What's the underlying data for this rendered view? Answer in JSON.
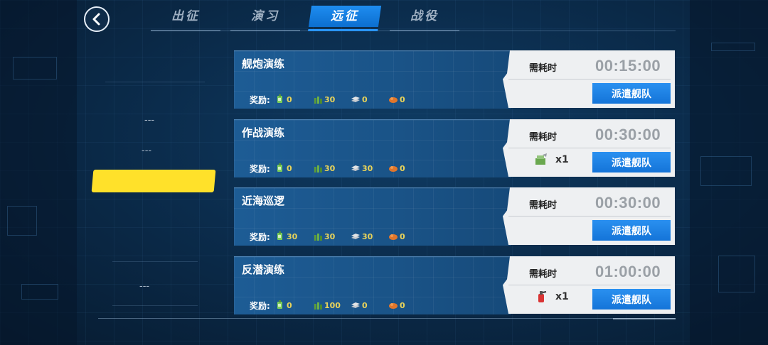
{
  "tabs": [
    {
      "label": "出征",
      "active": false
    },
    {
      "label": "演习",
      "active": false
    },
    {
      "label": "远征",
      "active": true
    },
    {
      "label": "战役",
      "active": false
    }
  ],
  "left_panel": {
    "placeholders": [
      "---",
      "---",
      "---"
    ],
    "selected_color": "#ffe12a"
  },
  "reward_label": "奖励:",
  "need_label": "需耗时",
  "dispatch_label": "派遣舰队",
  "expeditions": [
    {
      "title": "舰炮演练",
      "time": "00:15:00",
      "rewards": {
        "fuel": "0",
        "ammo": "30",
        "steel": "0",
        "bauxite": "0"
      },
      "extra": null
    },
    {
      "title": "作战演练",
      "time": "00:30:00",
      "rewards": {
        "fuel": "0",
        "ammo": "30",
        "steel": "30",
        "bauxite": "0"
      },
      "extra": {
        "icon": "build-material-icon",
        "qty": "x1"
      }
    },
    {
      "title": "近海巡逻",
      "time": "00:30:00",
      "rewards": {
        "fuel": "30",
        "ammo": "30",
        "steel": "30",
        "bauxite": "0"
      },
      "extra": null
    },
    {
      "title": "反潜演练",
      "time": "01:00:00",
      "rewards": {
        "fuel": "0",
        "ammo": "100",
        "steel": "0",
        "bauxite": "0"
      },
      "extra": {
        "icon": "fast-repair-icon",
        "qty": "x1"
      }
    }
  ],
  "colors": {
    "accent": "#1e8df0",
    "reward_text": "#e8d35a",
    "time_text": "#9aa0a6"
  }
}
